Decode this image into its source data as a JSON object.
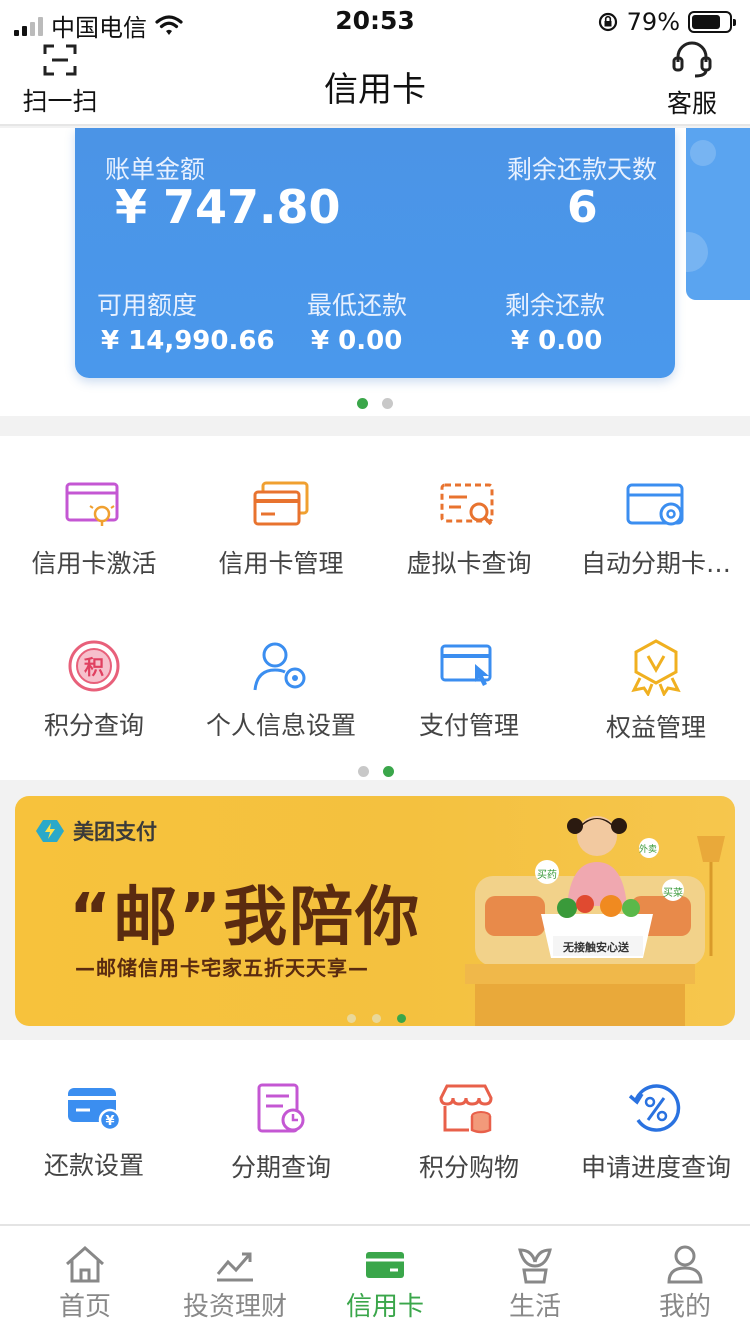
{
  "status_bar": {
    "carrier": "中国电信",
    "time": "20:53",
    "battery": "79%",
    "battery_level": 0.79
  },
  "nav": {
    "title": "信用卡",
    "scan_label": "扫一扫",
    "service_label": "客服"
  },
  "card": {
    "bill_label": "账单金额",
    "bill_amount": "¥ 747.80",
    "days_label": "剩余还款天数",
    "days_value": "6",
    "available_label": "可用额度",
    "available_value": "¥ 14,990.66",
    "min_label": "最低还款",
    "min_value": "¥ 0.00",
    "remaining_label": "剩余还款",
    "remaining_value": "¥ 0.00"
  },
  "menu": {
    "items": [
      {
        "label": "信用卡激活",
        "icon": "card-activate-icon"
      },
      {
        "label": "信用卡管理",
        "icon": "card-manage-icon"
      },
      {
        "label": "虚拟卡查询",
        "icon": "virtual-card-search-icon"
      },
      {
        "label": "自动分期卡…",
        "icon": "auto-installment-card-icon"
      },
      {
        "label": "积分查询",
        "icon": "points-query-icon"
      },
      {
        "label": "个人信息设置",
        "icon": "personal-info-settings-icon"
      },
      {
        "label": "支付管理",
        "icon": "payment-manage-icon"
      },
      {
        "label": "权益管理",
        "icon": "benefits-manage-icon"
      }
    ]
  },
  "banner": {
    "brand": "美团支付",
    "title": "“邮”我陪你",
    "subtitle": "—邮储信用卡宅家五折天天享—",
    "box_text": "无接触安心送",
    "tag1": "买药",
    "tag2": "外卖",
    "tag3": "买菜"
  },
  "menu2": {
    "items": [
      {
        "label": "还款设置",
        "icon": "repayment-settings-icon"
      },
      {
        "label": "分期查询",
        "icon": "installment-query-icon"
      },
      {
        "label": "积分购物",
        "icon": "points-shopping-icon"
      },
      {
        "label": "申请进度查询",
        "icon": "application-progress-icon"
      }
    ]
  },
  "tabs": [
    {
      "label": "首页",
      "icon": "home-icon"
    },
    {
      "label": "投资理财",
      "icon": "investment-icon"
    },
    {
      "label": "信用卡",
      "icon": "credit-card-icon"
    },
    {
      "label": "生活",
      "icon": "life-sprout-icon"
    },
    {
      "label": "我的",
      "icon": "profile-icon"
    }
  ],
  "colors": {
    "card_blue": "#4a96e8",
    "accent_green": "#3aa64a",
    "banner_yellow": "#f5c23f"
  }
}
